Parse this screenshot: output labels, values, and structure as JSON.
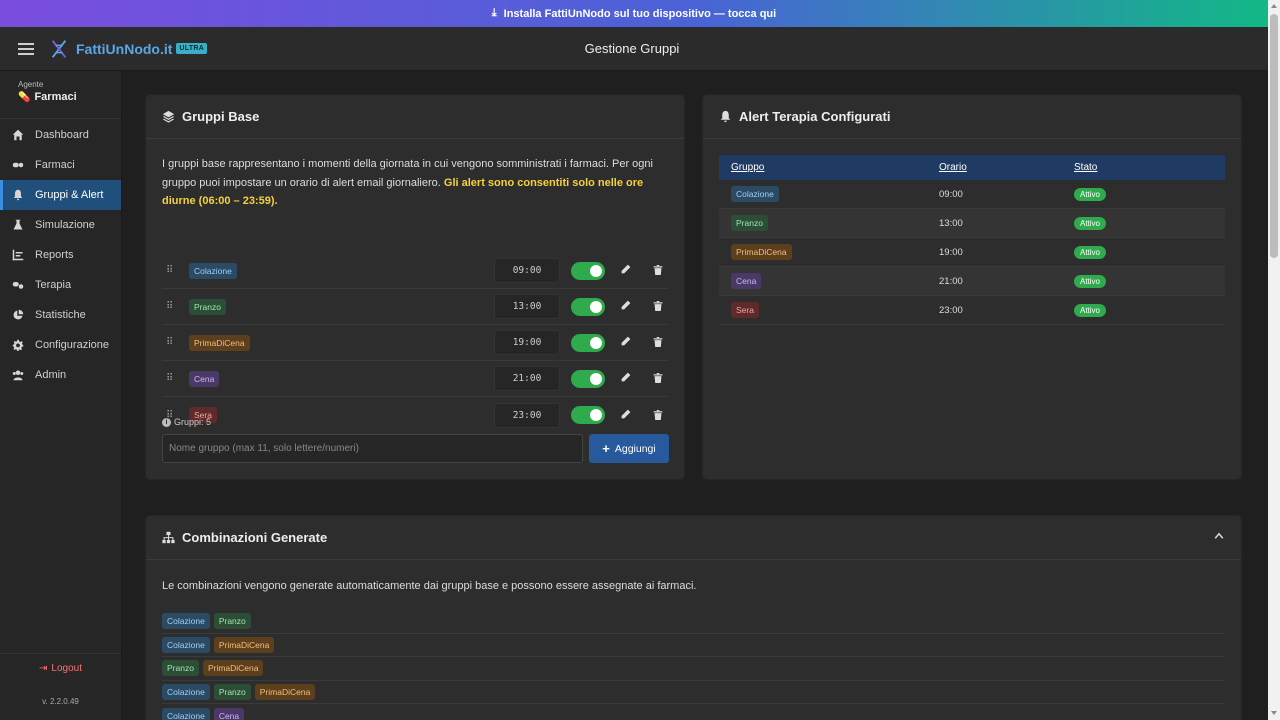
{
  "install_bar": {
    "text": "Installa FattiUnNodo sul tuo dispositivo — tocca qui"
  },
  "header": {
    "logo_text": "FattiUnNodo.it",
    "badge": "ULTRA",
    "title": "Gestione Gruppi"
  },
  "sidebar": {
    "agent_label": "Agente",
    "agent_name": "Farmaci",
    "items": [
      {
        "label": "Dashboard",
        "icon": "home-icon",
        "active": false
      },
      {
        "label": "Farmaci",
        "icon": "pills-icon",
        "active": false
      },
      {
        "label": "Gruppi & Alert",
        "icon": "bell-icon",
        "active": true
      },
      {
        "label": "Simulazione",
        "icon": "flask-icon",
        "active": false
      },
      {
        "label": "Reports",
        "icon": "chart-icon",
        "active": false
      },
      {
        "label": "Terapia",
        "icon": "capsules-icon",
        "active": false
      },
      {
        "label": "Statistiche",
        "icon": "pie-chart-icon",
        "active": false
      },
      {
        "label": "Configurazione",
        "icon": "gear-icon",
        "active": false
      },
      {
        "label": "Admin",
        "icon": "users-icon",
        "active": false
      }
    ],
    "logout": "Logout",
    "version": "v. 2.2.0.49"
  },
  "base_groups": {
    "title": "Gruppi Base",
    "description": "I gruppi base rappresentano i momenti della giornata in cui vengono somministrati i farmaci. Per ogni gruppo puoi impostare un orario di alert email giornaliero.",
    "highlight": "Gli alert sono consentiti solo nelle ore diurne (06:00 – 23:59).",
    "rows": [
      {
        "name": "Colazione",
        "time": "09:00",
        "enabled": true
      },
      {
        "name": "Pranzo",
        "time": "13:00",
        "enabled": true
      },
      {
        "name": "PrimaDiCena",
        "time": "19:00",
        "enabled": true
      },
      {
        "name": "Cena",
        "time": "21:00",
        "enabled": true
      },
      {
        "name": "Sera",
        "time": "23:00",
        "enabled": true
      }
    ],
    "count_label": "Gruppi: 5",
    "input_placeholder": "Nome gruppo (max 11, solo lettere/numeri)",
    "add_label": "Aggiungi"
  },
  "alerts": {
    "title": "Alert Terapia Configurati",
    "columns": [
      "Gruppo",
      "Orario",
      "Stato"
    ],
    "rows": [
      {
        "group": "Colazione",
        "time": "09:00",
        "status": "Attivo"
      },
      {
        "group": "Pranzo",
        "time": "13:00",
        "status": "Attivo"
      },
      {
        "group": "PrimaDiCena",
        "time": "19:00",
        "status": "Attivo"
      },
      {
        "group": "Cena",
        "time": "21:00",
        "status": "Attivo"
      },
      {
        "group": "Sera",
        "time": "23:00",
        "status": "Attivo"
      }
    ]
  },
  "combinations": {
    "title": "Combinazioni Generate",
    "description": "Le combinazioni vengono generate automaticamente dai gruppi base e possono essere assegnate ai farmaci.",
    "rows": [
      [
        "Colazione",
        "Pranzo"
      ],
      [
        "Colazione",
        "PrimaDiCena"
      ],
      [
        "Pranzo",
        "PrimaDiCena"
      ],
      [
        "Colazione",
        "Pranzo",
        "PrimaDiCena"
      ],
      [
        "Colazione",
        "Cena"
      ]
    ]
  },
  "colors": {
    "accent": "#265a9c",
    "active_nav": "#1f4f7a",
    "toggle_on": "#2faa4c",
    "highlight": "#f5d13b",
    "logout": "#ff7070"
  }
}
